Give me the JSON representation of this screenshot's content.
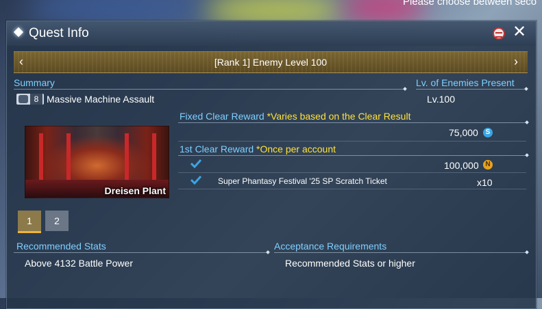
{
  "background": {
    "top_text": "Please choose between seco"
  },
  "window": {
    "title": "Quest Info"
  },
  "rank_selector": {
    "label": "[Rank 1] Enemy Level 100"
  },
  "summary": {
    "header": "Summary",
    "party_count": "8",
    "quest_name": "Massive Machine Assault",
    "image_caption": "Dreisen Plant"
  },
  "enemy_level": {
    "header": "Lv. of Enemies Present",
    "value": "Lv.100"
  },
  "fixed_reward": {
    "header": "Fixed Clear Reward",
    "note": "*Varies based on the Clear Result",
    "amount": "75,000",
    "currency_icon": "S"
  },
  "first_clear": {
    "header": "1st Clear Reward",
    "note": "*Once per account",
    "items": [
      {
        "name": "",
        "amount": "100,000",
        "icon": "N"
      },
      {
        "name": "Super Phantasy Festival '25 SP Scratch Ticket",
        "amount": "x10"
      }
    ]
  },
  "pages": {
    "items": [
      "1",
      "2"
    ],
    "active": "1"
  },
  "recommended_stats": {
    "header": "Recommended Stats",
    "value": "Above 4132 Battle Power"
  },
  "acceptance": {
    "header": "Acceptance Requirements",
    "value": "Recommended Stats or higher"
  },
  "colors": {
    "header": "#7fd0ff",
    "note": "#ffe23a",
    "accent": "#f0b43a"
  }
}
